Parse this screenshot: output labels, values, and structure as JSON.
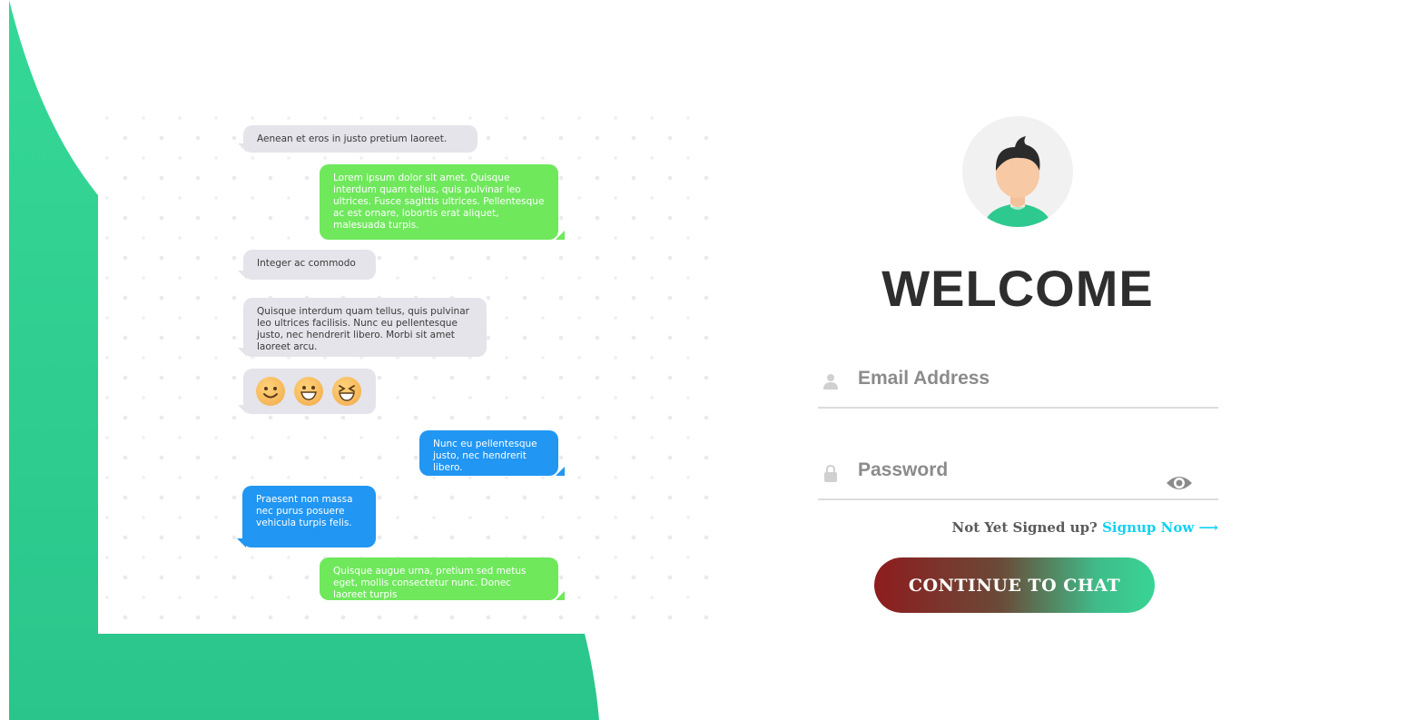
{
  "colors": {
    "background_accent": "#2fd08f",
    "green_bubble": "#6fe85c",
    "blue_bubble": "#2196f3",
    "incoming_bubble": "#e4e4ea",
    "signup_link": "#13d1f0",
    "button_gradient_start": "#8e1c1e",
    "button_gradient_end": "#38d494"
  },
  "chat": {
    "messages": [
      {
        "side": "incoming",
        "color": "gray",
        "text": "Aenean et eros in justo pretium laoreet."
      },
      {
        "side": "outgoing",
        "color": "green",
        "text": "Lorem ipsum dolor sit amet. Quisque interdum quam tellus, quis pulvinar leo ultrices. Fusce sagittis ultrices. Pellentesque ac est ornare, lobortis erat aliquet, malesuada turpis."
      },
      {
        "side": "incoming",
        "color": "gray",
        "text": "Integer ac commodo"
      },
      {
        "side": "incoming",
        "color": "gray",
        "text": "Quisque interdum quam tellus, quis pulvinar leo ultrices facilisis. Nunc eu pellentesque justo, nec hendrerit libero. Morbi sit amet laoreet arcu."
      },
      {
        "side": "incoming",
        "color": "gray",
        "emojis": [
          "smile-emoji-icon",
          "grin-emoji-icon",
          "laugh-emoji-icon"
        ]
      },
      {
        "side": "outgoing",
        "color": "blue",
        "text": "Nunc eu pellentesque justo, nec hendrerit libero."
      },
      {
        "side": "incoming",
        "color": "blue",
        "text": "Praesent non massa nec purus posuere vehicula turpis felis."
      },
      {
        "side": "outgoing",
        "color": "green",
        "text": "Quisque augue urna, pretium sed metus eget, mollis consectetur nunc. Donec laoreet turpis"
      }
    ]
  },
  "login": {
    "avatar_icon": "user-avatar-icon",
    "title": "WELCOME",
    "email_placeholder": "Email Address",
    "email_value": "",
    "email_icon": "user-icon",
    "password_placeholder": "Password",
    "password_value": "",
    "password_icon": "lock-icon",
    "toggle_icon": "eye-icon",
    "signup_prompt": "Not Yet Signed up?",
    "signup_link": "Signup Now",
    "signup_arrow": "⟶",
    "continue_label": "CONTINUE TO CHAT"
  }
}
